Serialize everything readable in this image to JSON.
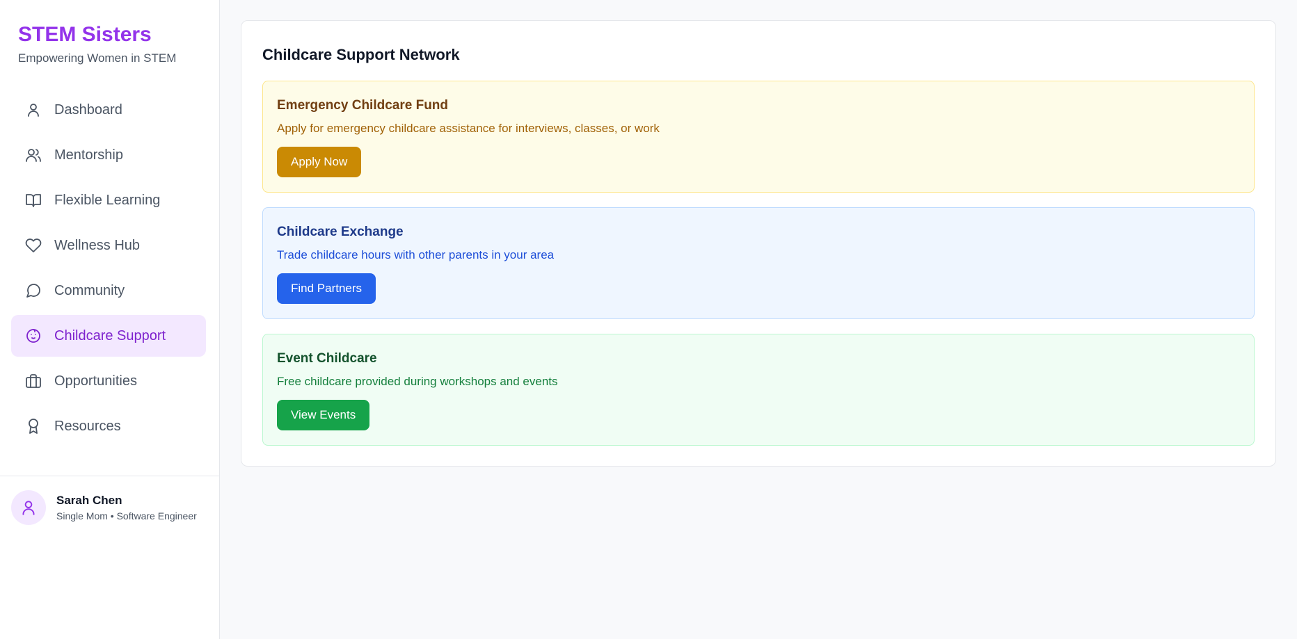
{
  "brand": {
    "title": "STEM Sisters",
    "subtitle": "Empowering Women in STEM",
    "accent": "#9333ea"
  },
  "sidebar": {
    "items": [
      {
        "label": "Dashboard",
        "icon": "user-icon",
        "active": false
      },
      {
        "label": "Mentorship",
        "icon": "users-icon",
        "active": false
      },
      {
        "label": "Flexible Learning",
        "icon": "book-open-icon",
        "active": false
      },
      {
        "label": "Wellness Hub",
        "icon": "heart-icon",
        "active": false
      },
      {
        "label": "Community",
        "icon": "message-circle-icon",
        "active": false
      },
      {
        "label": "Childcare Support",
        "icon": "baby-icon",
        "active": true
      },
      {
        "label": "Opportunities",
        "icon": "briefcase-icon",
        "active": false
      },
      {
        "label": "Resources",
        "icon": "award-icon",
        "active": false
      }
    ]
  },
  "profile": {
    "name": "Sarah Chen",
    "role": "Single Mom • Software Engineer",
    "icon": "user-icon"
  },
  "main": {
    "title": "Childcare Support Network",
    "panels": [
      {
        "title": "Emergency Childcare Fund",
        "description": "Apply for emergency childcare assistance for interviews, classes, or work",
        "button": "Apply Now",
        "color": "#ca8a04"
      },
      {
        "title": "Childcare Exchange",
        "description": "Trade childcare hours with other parents in your area",
        "button": "Find Partners",
        "color": "#2563eb"
      },
      {
        "title": "Event Childcare",
        "description": "Free childcare provided during workshops and events",
        "button": "View Events",
        "color": "#16a34a"
      }
    ]
  }
}
